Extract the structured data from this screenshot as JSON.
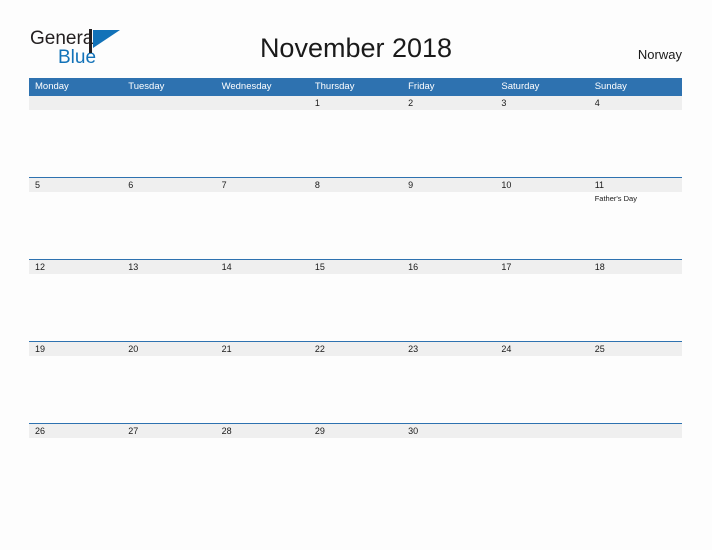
{
  "brand": {
    "name_part1": "General",
    "name_part2": "Blue",
    "flag_icon": "flag-triangle-icon",
    "color_dark": "#231f20",
    "color_blue": "#1272b8"
  },
  "header": {
    "title": "November 2018",
    "country": "Norway"
  },
  "theme": {
    "header_blue": "#2e72b0",
    "band_gray": "#efefef",
    "separator_blue": "#2e72b0",
    "page_background": "#fdfdfd",
    "text_color": "#1a1a1a"
  },
  "calendar": {
    "month": "November",
    "year": "2018",
    "week_start": "Monday",
    "weekday_headers": [
      "Monday",
      "Tuesday",
      "Wednesday",
      "Thursday",
      "Friday",
      "Saturday",
      "Sunday"
    ],
    "weeks": [
      {
        "days": [
          {
            "date": "",
            "event": ""
          },
          {
            "date": "",
            "event": ""
          },
          {
            "date": "",
            "event": ""
          },
          {
            "date": "1",
            "event": ""
          },
          {
            "date": "2",
            "event": ""
          },
          {
            "date": "3",
            "event": ""
          },
          {
            "date": "4",
            "event": ""
          }
        ]
      },
      {
        "days": [
          {
            "date": "5",
            "event": ""
          },
          {
            "date": "6",
            "event": ""
          },
          {
            "date": "7",
            "event": ""
          },
          {
            "date": "8",
            "event": ""
          },
          {
            "date": "9",
            "event": ""
          },
          {
            "date": "10",
            "event": ""
          },
          {
            "date": "11",
            "event": "Father's Day"
          }
        ]
      },
      {
        "days": [
          {
            "date": "12",
            "event": ""
          },
          {
            "date": "13",
            "event": ""
          },
          {
            "date": "14",
            "event": ""
          },
          {
            "date": "15",
            "event": ""
          },
          {
            "date": "16",
            "event": ""
          },
          {
            "date": "17",
            "event": ""
          },
          {
            "date": "18",
            "event": ""
          }
        ]
      },
      {
        "days": [
          {
            "date": "19",
            "event": ""
          },
          {
            "date": "20",
            "event": ""
          },
          {
            "date": "21",
            "event": ""
          },
          {
            "date": "22",
            "event": ""
          },
          {
            "date": "23",
            "event": ""
          },
          {
            "date": "24",
            "event": ""
          },
          {
            "date": "25",
            "event": ""
          }
        ]
      },
      {
        "days": [
          {
            "date": "26",
            "event": ""
          },
          {
            "date": "27",
            "event": ""
          },
          {
            "date": "28",
            "event": ""
          },
          {
            "date": "29",
            "event": ""
          },
          {
            "date": "30",
            "event": ""
          },
          {
            "date": "",
            "event": ""
          },
          {
            "date": "",
            "event": ""
          }
        ]
      }
    ]
  }
}
